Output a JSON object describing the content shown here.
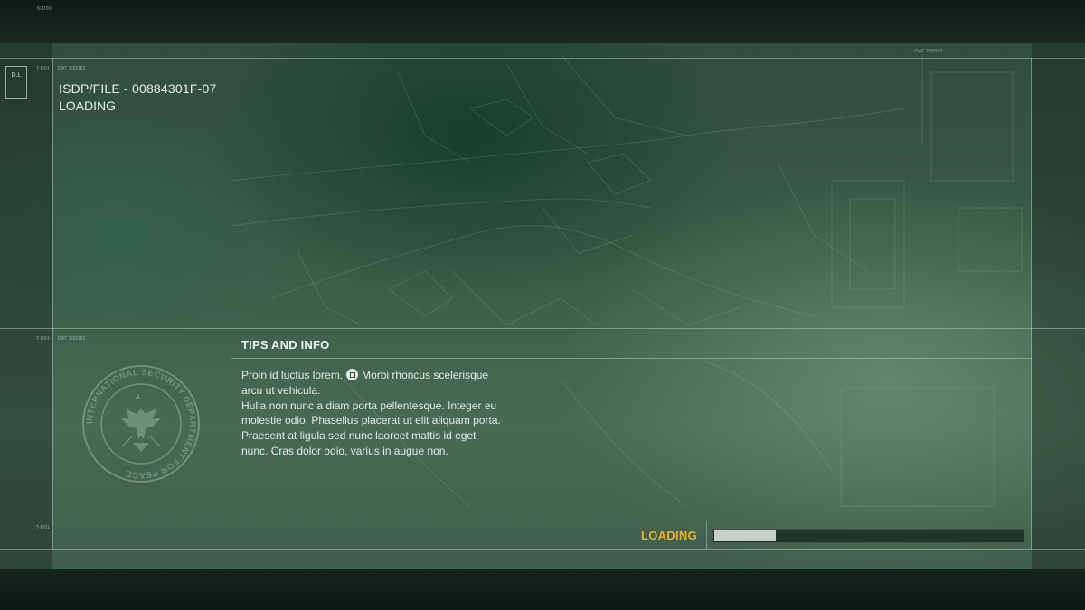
{
  "hud": {
    "top_code": "N-D00",
    "dl_label": "D.L",
    "row_code_1": "T-D01",
    "row_code_2": "T-D01",
    "row_code_3": "T-D01",
    "dat_code_1": "DAT 200082",
    "dat_code_2": "DAT 200082",
    "dat_code_3": "DAT 200082"
  },
  "file": {
    "title": "ISDP/FILE - 00884301F-07",
    "status": "LOADING"
  },
  "tips": {
    "title": "TIPS AND INFO",
    "line1_before": "Proin id luctus lorem.",
    "line1_after": "Morbi rhoncus scelerisque",
    "line2": "arcu ut vehicula.",
    "line3": "Hulla non nunc a diam porta pellentesque. Integer eu",
    "line4": "molestie odio. Phasellus placerat ut elit aliquam porta.",
    "line5": "Praesent at ligula sed nunc laoreet mattis id eget",
    "line6": "nunc. Cras dolor odio, varius in augue non.",
    "button_icon": "square-button-icon"
  },
  "seal": {
    "text": "INTERNATIONAL SECURITY DEPARTMENT FOR PEACE",
    "icon": "eagle-icon"
  },
  "loading": {
    "label": "LOADING",
    "progress": 0.2,
    "fill_color": "#c9cfcb",
    "label_color": "#e8b12c"
  }
}
